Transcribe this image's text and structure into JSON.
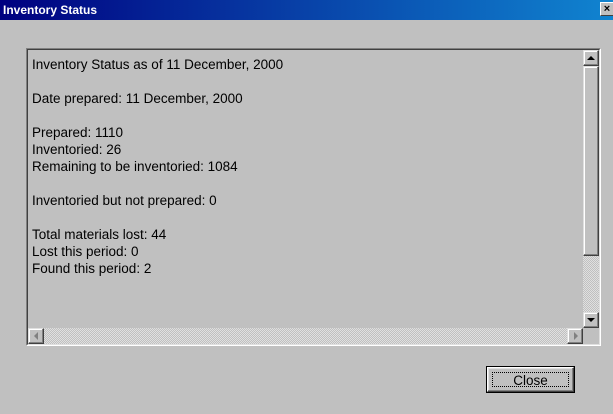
{
  "window": {
    "title": "Inventory Status",
    "close_glyph": "×"
  },
  "report": {
    "lines": [
      "Inventory Status as of 11 December, 2000",
      "",
      "Date prepared: 11 December, 2000",
      "",
      "Prepared: 1110",
      "Inventoried: 26",
      "Remaining to be inventoried: 1084",
      "",
      "Inventoried but not prepared: 0",
      "",
      "Total materials lost: 44",
      "Lost this period: 0",
      "Found this period: 2"
    ]
  },
  "buttons": {
    "close_label": "Close"
  },
  "icons": {
    "scroll_up": "arrow-up-icon",
    "scroll_down": "arrow-down-icon",
    "scroll_left": "arrow-left-icon",
    "scroll_right": "arrow-right-icon"
  },
  "colors": {
    "title_start": "#000080",
    "title_end": "#1084d0",
    "face": "#c0c0c0"
  }
}
